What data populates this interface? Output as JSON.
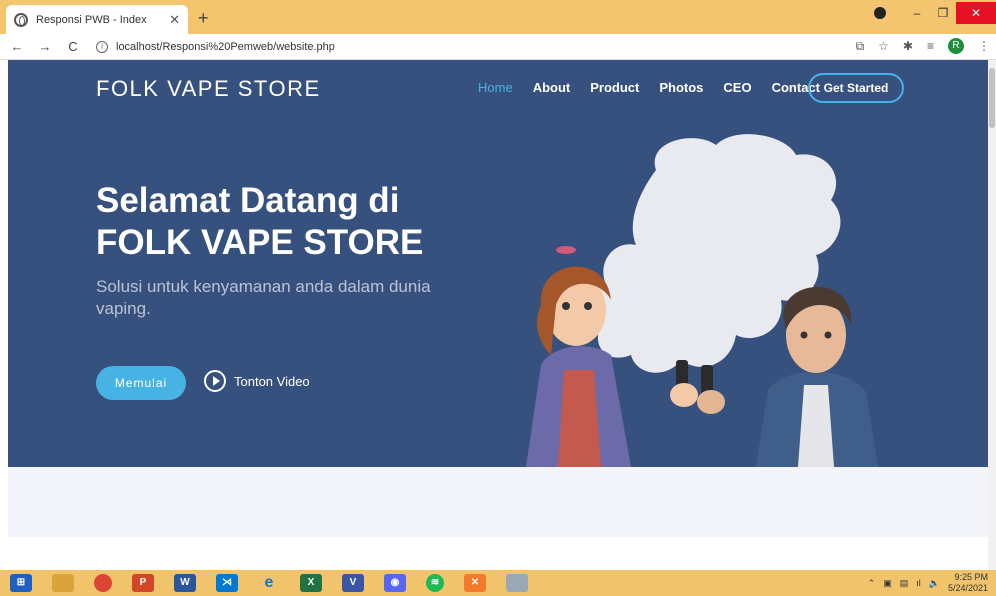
{
  "browser": {
    "tab_title": "Responsi PWB - Index",
    "url": "localhost/Responsi%20Pemweb/website.php",
    "profile_initial": "R"
  },
  "site": {
    "brand": "FOLK VAPE STORE",
    "nav": [
      "Home",
      "About",
      "Product",
      "Photos",
      "CEO",
      "Contact"
    ],
    "cta": "Get Started",
    "headline_line1": "Selamat Datang di",
    "headline_line2": "FOLK VAPE STORE",
    "subtitle": "Solusi untuk kenyamanan anda dalam dunia vaping.",
    "start_button": "Memulai",
    "watch_video": "Tonton Video"
  },
  "taskbar": {
    "time": "9:25 PM",
    "date": "5/24/2021"
  },
  "colors": {
    "hero_bg": "#37517e",
    "accent": "#47b2e4",
    "taskbar": "#f1c46c"
  }
}
